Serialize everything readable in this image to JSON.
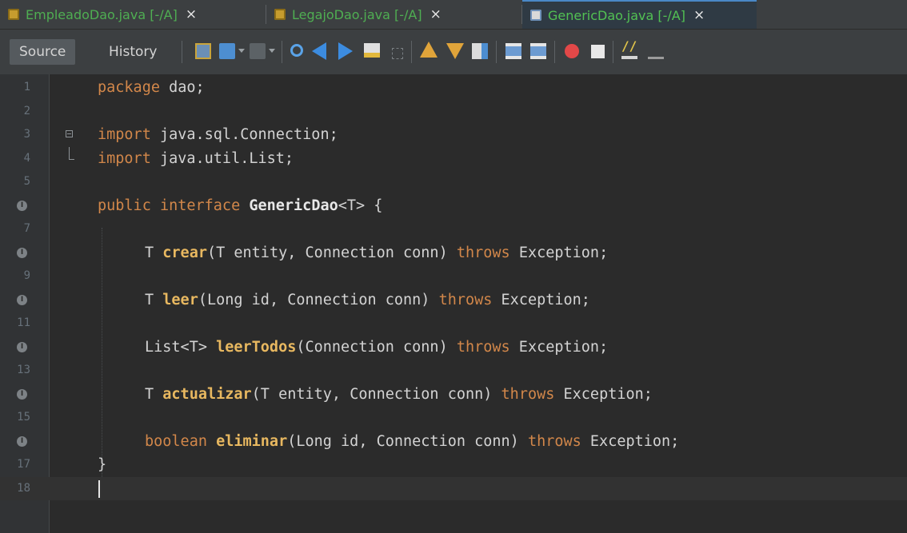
{
  "tabs": [
    {
      "label": "EmpleadoDao.java",
      "suffix": " [-/A]",
      "close": "×",
      "active": false
    },
    {
      "label": "LegajoDao.java",
      "suffix": " [-/A]",
      "close": "×",
      "active": false
    },
    {
      "label": "GenericDao.java",
      "suffix": " [-/A]",
      "close": "×",
      "active": true
    }
  ],
  "toolbar": {
    "source_label": "Source",
    "history_label": "History"
  },
  "editor": {
    "line_numbers": [
      "1",
      "2",
      "3",
      "4",
      "5",
      "",
      "7",
      "",
      "9",
      "",
      "11",
      "",
      "13",
      "",
      "15",
      "",
      "17",
      "18"
    ],
    "lines": [
      "package dao;",
      "",
      "import java.sql.Connection;",
      "import java.util.List;",
      "",
      "public interface GenericDao<T> {",
      "",
      "T crear(T entity, Connection conn) throws Exception;",
      "",
      "T leer(Long id, Connection conn) throws Exception;",
      "",
      "List<T> leerTodos(Connection conn) throws Exception;",
      "",
      "T actualizar(T entity, Connection conn) throws Exception;",
      "",
      "boolean eliminar(Long id, Connection conn) throws Exception;",
      "}",
      ""
    ],
    "marker_symbol": "I"
  }
}
